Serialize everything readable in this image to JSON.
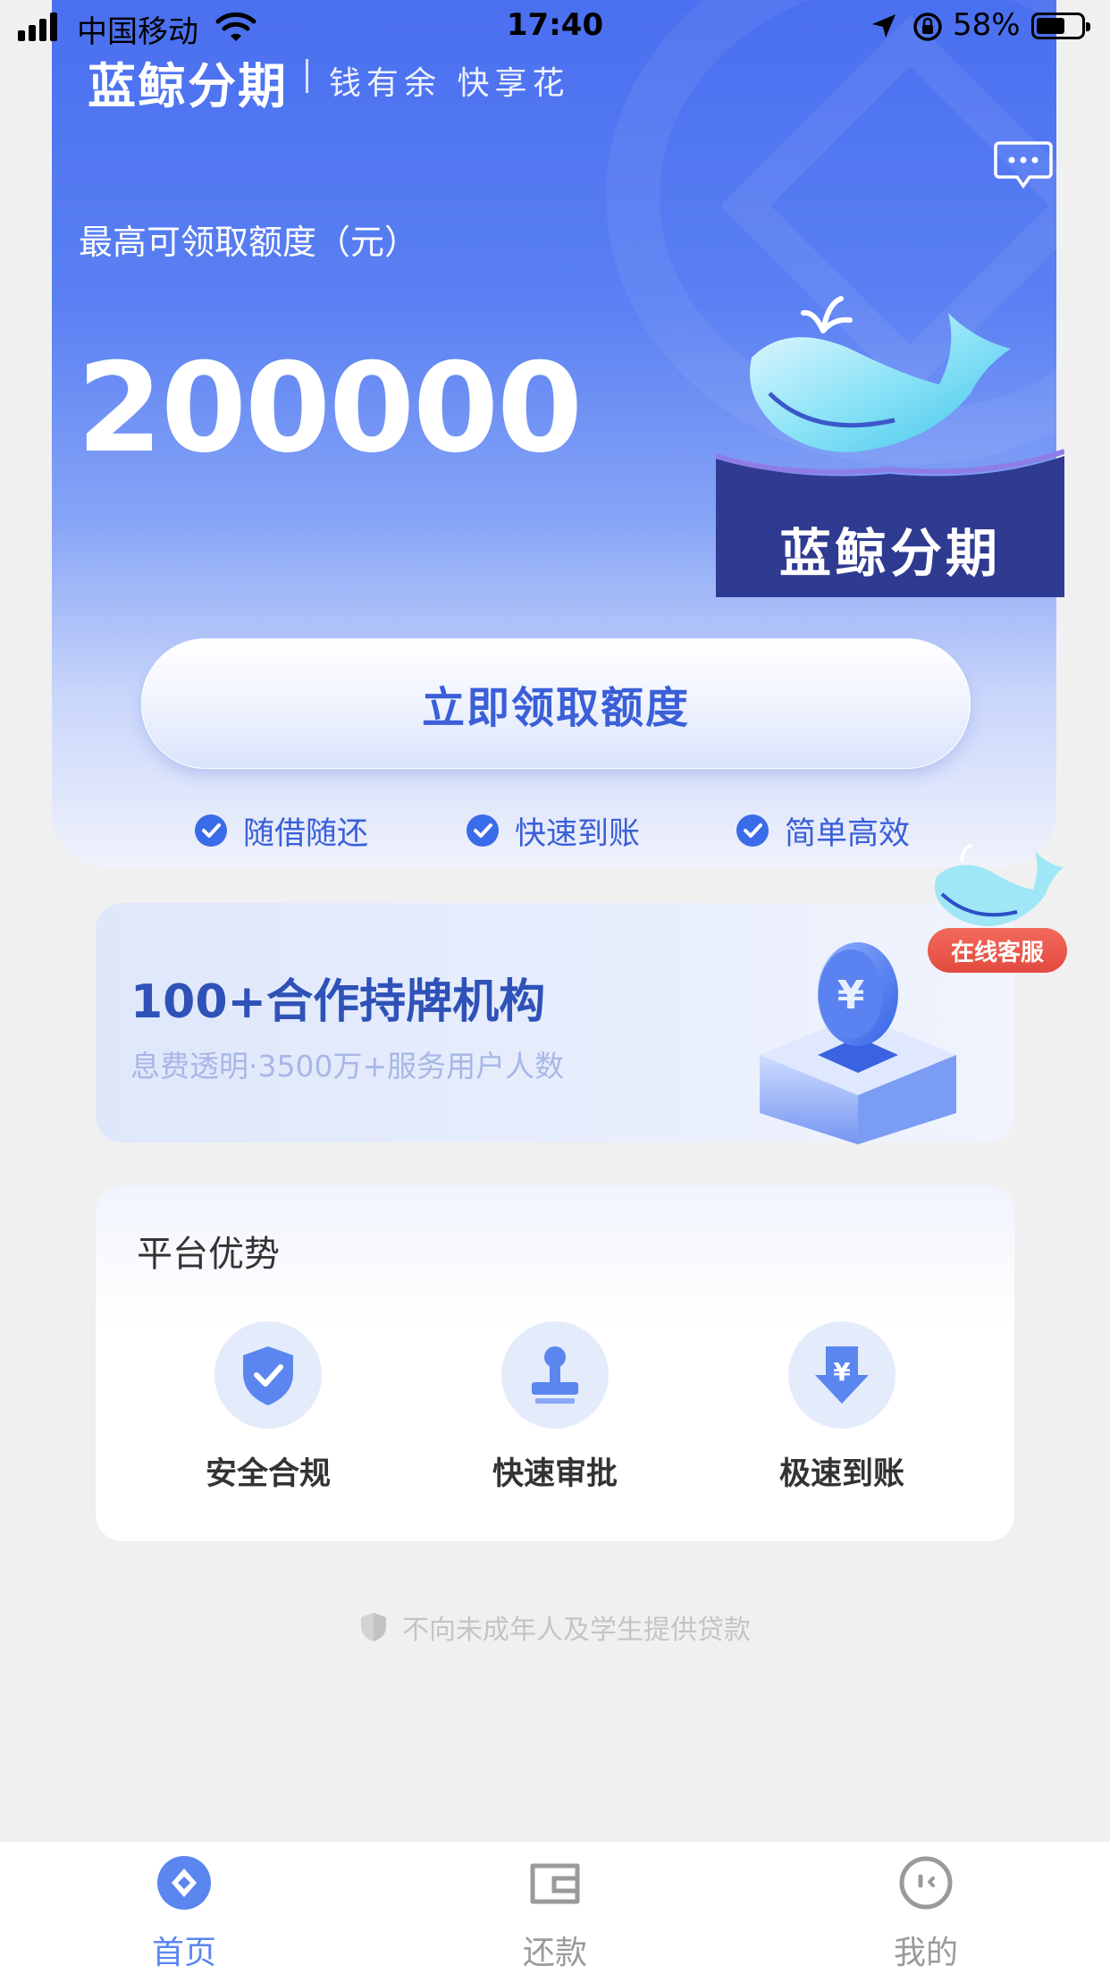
{
  "status_bar": {
    "carrier": "中国移动",
    "time": "17:40",
    "battery": "58%"
  },
  "brand": {
    "name": "蓝鲸分期",
    "slogan": "钱有余 快享花",
    "logo_text": "蓝鲸分期"
  },
  "hero": {
    "limit_label": "最高可领取额度（元）",
    "limit_value": "200000",
    "claim_button": "立即领取额度",
    "features": [
      "随借随还",
      "快速到账",
      "简单高效"
    ]
  },
  "online_service": {
    "label": "在线客服"
  },
  "cooperation": {
    "title": "100+合作持牌机构",
    "subtitle": "息费透明·3500万+服务用户人数"
  },
  "advantages": {
    "title": "平台优势",
    "items": [
      {
        "label": "安全合规",
        "icon": "shield-check-icon"
      },
      {
        "label": "快速审批",
        "icon": "stamp-icon"
      },
      {
        "label": "极速到账",
        "icon": "yuan-arrow-down-icon"
      }
    ]
  },
  "notice": "不向未成年人及学生提供贷款",
  "tabs": [
    {
      "label": "首页",
      "icon": "home-icon",
      "active": true
    },
    {
      "label": "还款",
      "icon": "wallet-icon",
      "active": false
    },
    {
      "label": "我的",
      "icon": "profile-icon",
      "active": false
    }
  ],
  "colors": {
    "primary": "#3a5fd8",
    "hero_top": "#4a6ff0",
    "badge_red": "#e24a3e",
    "tab_active": "#5b86f0",
    "tab_inactive": "#9a9a9a"
  }
}
